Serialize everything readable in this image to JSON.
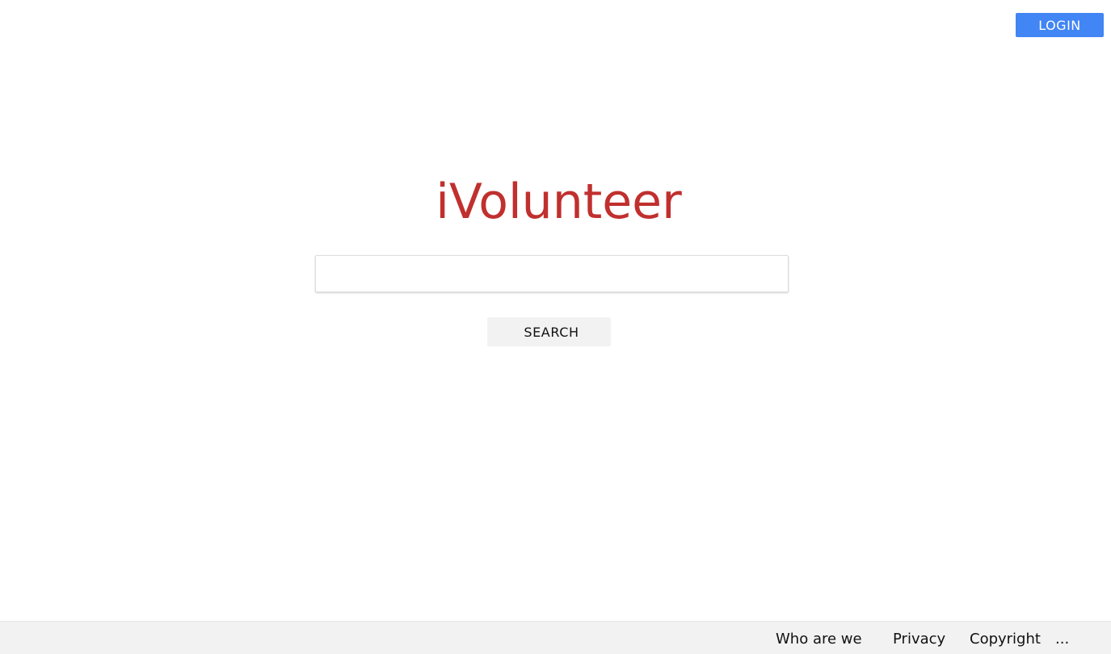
{
  "header": {
    "login_label": "LOGIN"
  },
  "main": {
    "logo_text": "iVolunteer",
    "search": {
      "value": "",
      "placeholder": ""
    },
    "search_button_label": "SEARCH"
  },
  "footer": {
    "links": [
      {
        "label": "Who are we"
      },
      {
        "label": "Privacy"
      },
      {
        "label": "Copyright"
      },
      {
        "label": "..."
      }
    ]
  },
  "colors": {
    "brand": "#c0302e",
    "login_button": "#4285f4",
    "footer_background": "#f2f2f2",
    "search_button_background": "#f2f2f2"
  }
}
